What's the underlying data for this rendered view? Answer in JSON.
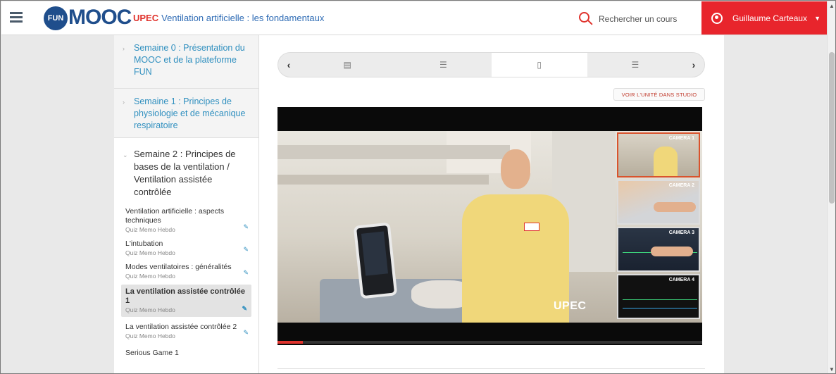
{
  "header": {
    "logo_short": "FUN",
    "logo_brand": "MOOC",
    "course_org": "UPEC",
    "course_title": "Ventilation artificielle : les fondamentaux",
    "search_placeholder": "Rechercher un cours",
    "user_name": "Guillaume Carteaux"
  },
  "sidebar": {
    "weeks": [
      {
        "label": "Semaine 0 : Présentation du MOOC et de la plateforme FUN"
      },
      {
        "label": "Semaine 1 : Principes de physiologie et de mécanique respiratoire"
      },
      {
        "label": "Semaine 2 : Principes de bases de la ventilation / Ventilation assistée contrôlée"
      }
    ],
    "lessons": [
      {
        "title": "Ventilation artificielle : aspects techniques",
        "sub": "Quiz Memo Hebdo"
      },
      {
        "title": "L'intubation",
        "sub": "Quiz Memo Hebdo"
      },
      {
        "title": "Modes ventilatoires : généralités",
        "sub": "Quiz Memo Hebdo"
      },
      {
        "title": "La ventilation assistée contrôlée 1",
        "sub": "Quiz Memo Hebdo"
      },
      {
        "title": "La ventilation assistée contrôlée 2",
        "sub": "Quiz Memo Hebdo"
      },
      {
        "title": "Serious Game 1",
        "sub": ""
      }
    ]
  },
  "main": {
    "studio_button": "VOIR L'UNITÉ DANS STUDIO",
    "video": {
      "watermark": "UPEC",
      "progress_fraction": 0.06,
      "cameras": [
        "Camera 1",
        "Camera 2",
        "Camera 3",
        "Camera 4"
      ]
    }
  },
  "colors": {
    "brand_blue": "#1f4e8c",
    "accent_red": "#e0332d",
    "user_red": "#e8252c",
    "link_blue": "#2f8fbf"
  }
}
